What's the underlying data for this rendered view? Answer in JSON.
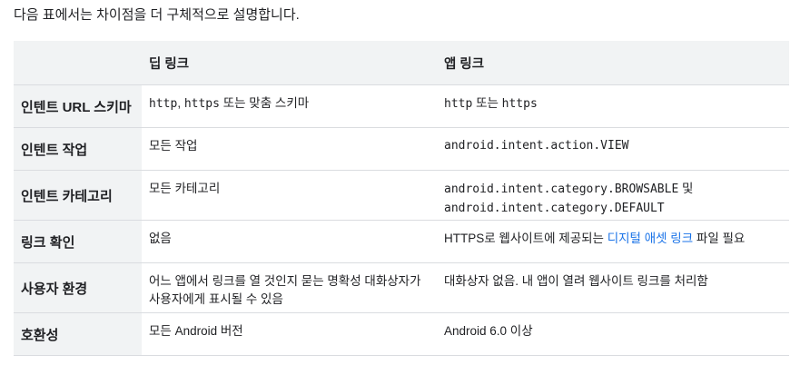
{
  "intro": "다음 표에서는 차이점을 더 구체적으로 설명합니다.",
  "table": {
    "headers": [
      "",
      "딥 링크",
      "앱 링크"
    ],
    "rows": [
      {
        "label": "인텐트 URL 스키마",
        "deep": {
          "code1": "http",
          "text1": ", ",
          "code2": "https",
          "text2": " 또는 맞춤 스키마"
        },
        "app": {
          "code1": "http",
          "text1": " 또는 ",
          "code2": "https"
        }
      },
      {
        "label": "인텐트 작업",
        "deep": "모든 작업",
        "app": "android.intent.action.VIEW"
      },
      {
        "label": "인텐트 카테고리",
        "deep": "모든 카테고리",
        "app": {
          "code1": "android.intent.category.BROWSABLE",
          "text1": " 및 ",
          "code2": "android.intent.category.DEFAULT"
        }
      },
      {
        "label": "링크 확인",
        "deep": "없음",
        "app": {
          "text1": "HTTPS로 웹사이트에 제공되는 ",
          "link": "디지털 애셋 링크",
          "text2": " 파일 필요"
        }
      },
      {
        "label": "사용자 환경",
        "deep": "어느 앱에서 링크를 열 것인지 묻는 명확성 대화상자가 사용자에게 표시될 수 있음",
        "app": "대화상자 없음. 내 앱이 열려 웹사이트 링크를 처리함"
      },
      {
        "label": "호환성",
        "deep": "모든 Android 버전",
        "app": "Android 6.0 이상"
      }
    ]
  }
}
